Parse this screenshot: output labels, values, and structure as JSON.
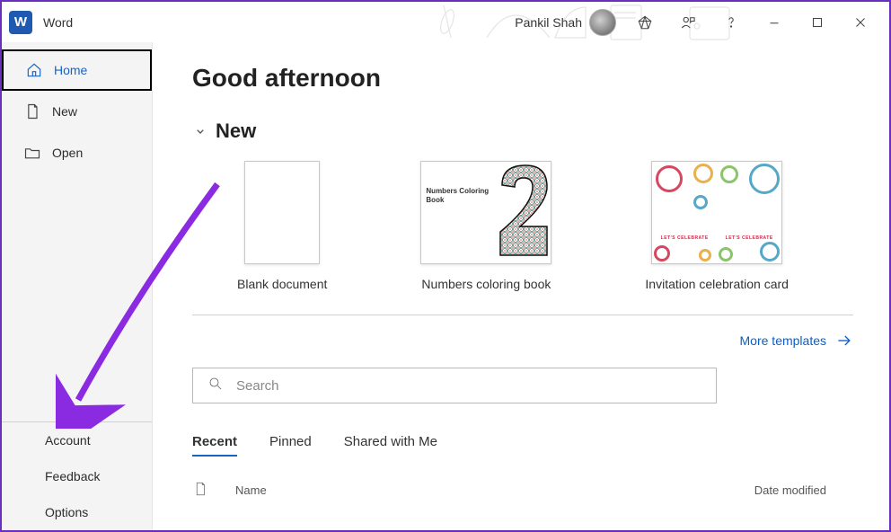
{
  "app": {
    "title": "Word",
    "user_name": "Pankil Shah"
  },
  "sidebar": {
    "top": [
      {
        "label": "Home"
      },
      {
        "label": "New"
      },
      {
        "label": "Open"
      }
    ],
    "bottom": [
      {
        "label": "Account"
      },
      {
        "label": "Feedback"
      },
      {
        "label": "Options"
      }
    ]
  },
  "main": {
    "greeting": "Good afternoon",
    "section_new": "New",
    "templates": [
      {
        "label": "Blank document"
      },
      {
        "label": "Numbers coloring book"
      },
      {
        "label": "Invitation celebration card"
      }
    ],
    "more_templates": "More templates",
    "search_placeholder": "Search",
    "tabs": [
      {
        "label": "Recent"
      },
      {
        "label": "Pinned"
      },
      {
        "label": "Shared with Me"
      }
    ],
    "columns": {
      "name": "Name",
      "date": "Date modified"
    },
    "numbers_thumb_text": "Numbers Coloring Book",
    "celebrate_text": "LET'S CELEBRATE"
  }
}
